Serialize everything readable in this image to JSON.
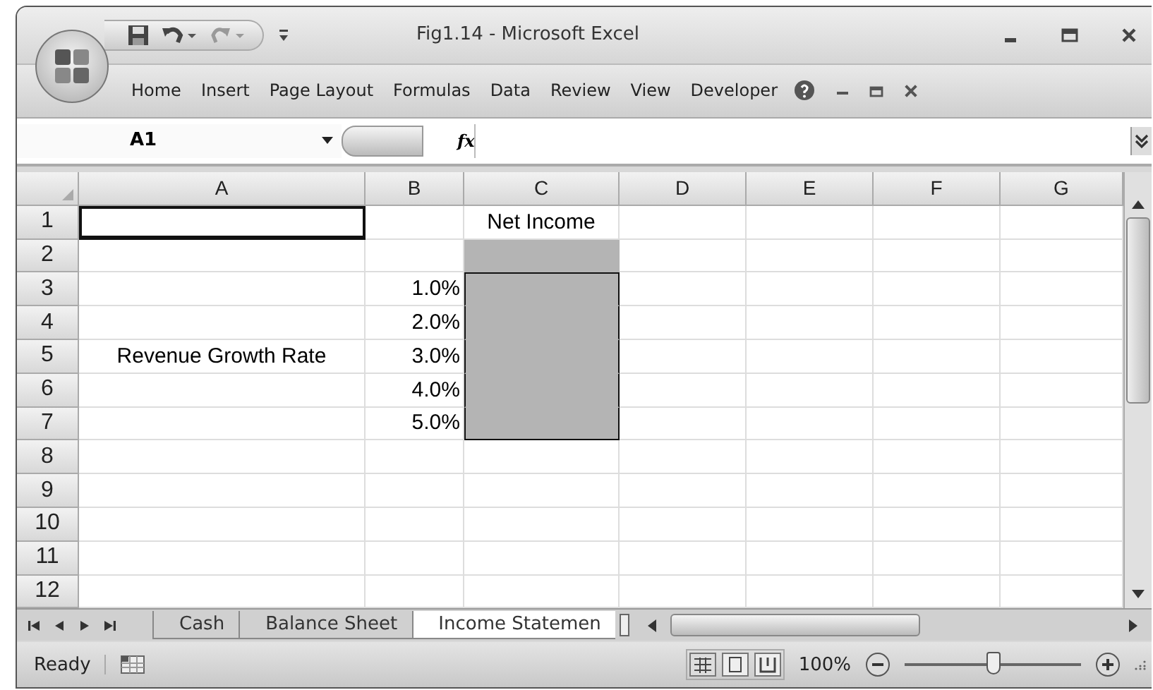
{
  "window": {
    "title": "Fig1.14 - Microsoft Excel"
  },
  "ribbon_tabs": [
    "Home",
    "Insert",
    "Page Layout",
    "Formulas",
    "Data",
    "Review",
    "View",
    "Developer"
  ],
  "name_box": "A1",
  "formula_bar": {
    "fx": "fx"
  },
  "columns": [
    "A",
    "B",
    "C",
    "D",
    "E",
    "F",
    "G"
  ],
  "rows": [
    {
      "number": "1",
      "cells": [
        {
          "active": true
        },
        {},
        {
          "text": "Net Income"
        },
        {},
        {},
        {},
        {}
      ]
    },
    {
      "number": "2",
      "cells": [
        {},
        {},
        {
          "shaded": true
        },
        {},
        {},
        {},
        {}
      ]
    },
    {
      "number": "3",
      "cells": [
        {},
        {
          "text": "1.0%"
        },
        {
          "shaded": true,
          "boxed": true
        },
        {},
        {},
        {},
        {}
      ]
    },
    {
      "number": "4",
      "cells": [
        {},
        {
          "text": "2.0%"
        },
        {
          "shaded": true,
          "boxed": true
        },
        {},
        {},
        {},
        {}
      ]
    },
    {
      "number": "5",
      "cells": [
        {
          "text": "Revenue Growth Rate"
        },
        {
          "text": "3.0%"
        },
        {
          "shaded": true,
          "boxed": true
        },
        {},
        {},
        {},
        {}
      ]
    },
    {
      "number": "6",
      "cells": [
        {},
        {
          "text": "4.0%"
        },
        {
          "shaded": true,
          "boxed": true
        },
        {},
        {},
        {},
        {}
      ]
    },
    {
      "number": "7",
      "cells": [
        {},
        {
          "text": "5.0%"
        },
        {
          "shaded": true,
          "boxed": true
        },
        {},
        {},
        {},
        {}
      ]
    },
    {
      "number": "8",
      "cells": [
        {},
        {},
        {},
        {},
        {},
        {},
        {}
      ]
    },
    {
      "number": "9",
      "cells": [
        {},
        {},
        {},
        {},
        {},
        {},
        {}
      ]
    },
    {
      "number": "10",
      "cells": [
        {},
        {},
        {},
        {},
        {},
        {},
        {}
      ]
    },
    {
      "number": "11",
      "cells": [
        {},
        {},
        {},
        {},
        {},
        {},
        {}
      ]
    },
    {
      "number": "12",
      "cells": [
        {},
        {},
        {},
        {},
        {},
        {},
        {}
      ]
    }
  ],
  "sheet_tabs": [
    {
      "label": "Cash",
      "selected": false
    },
    {
      "label": "Balance Sheet",
      "selected": false
    },
    {
      "label": "Income Statemen",
      "selected": true
    }
  ],
  "status_bar": {
    "status": "Ready",
    "zoom": "100%",
    "zoom_slider": {
      "level": 0.5
    }
  }
}
